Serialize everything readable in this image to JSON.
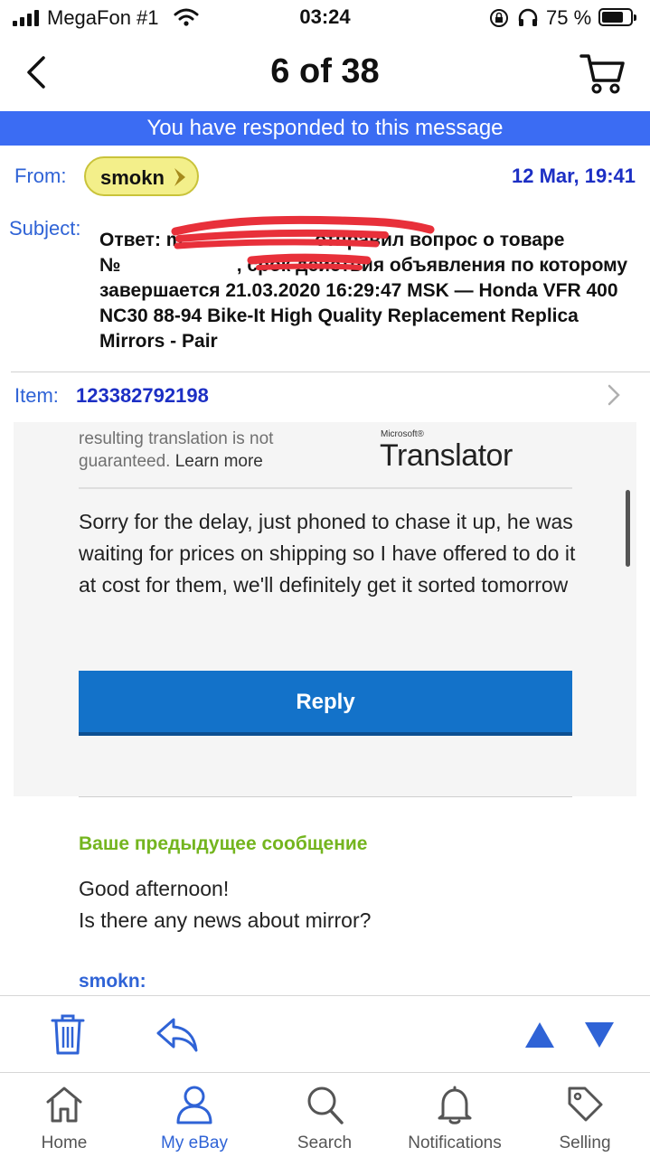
{
  "status_bar": {
    "carrier": "MegaFon #1",
    "time": "03:24",
    "battery_percent": "75 %",
    "battery_level": 0.75
  },
  "nav": {
    "title": "6 of 38"
  },
  "banner": {
    "text": "You have responded to this message"
  },
  "header": {
    "from_label": "From:",
    "sender": "smokn",
    "date": "12 Mar, 19:41",
    "subject_label": "Subject:",
    "subject": "Ответ: m                         отправил вопрос о товаре №                      , срок действия объявления по которому завершается 21.03.2020 16:29:47 MSK — Honda VFR 400 NC30 88-94 Bike-It High Quality Replacement Replica Mirrors - Pair",
    "item_label": "Item:",
    "item_number": "123382792198"
  },
  "message": {
    "disclaimer": "resulting translation is not guaranteed.",
    "learn_more": "Learn more",
    "translator_brand_small": "Microsoft®",
    "translator_brand": "Translator",
    "body": "Sorry for the delay, just phoned to chase it up, he was waiting for prices on shipping so I have offered to do it at cost for them, we'll definitely get it sorted tomorrow",
    "reply_label": "Reply"
  },
  "previous": {
    "heading": "Ваше предыдущее сообщение",
    "line1": "Good afternoon!",
    "line2": "Is there any news about mirror?",
    "next_sender": "smokn:"
  },
  "tabs": [
    {
      "label": "Home",
      "icon": "home-icon"
    },
    {
      "label": "My eBay",
      "icon": "person-icon",
      "active": true
    },
    {
      "label": "Search",
      "icon": "search-icon"
    },
    {
      "label": "Notifications",
      "icon": "bell-icon"
    },
    {
      "label": "Selling",
      "icon": "tag-icon"
    }
  ],
  "colors": {
    "banner": "#3b6cf3",
    "link_blue": "#2f63d6",
    "reply_button": "#1372c9",
    "previous_heading": "#74b51f",
    "sender_pill": "#f3ef8a",
    "redaction": "#e8303a"
  }
}
